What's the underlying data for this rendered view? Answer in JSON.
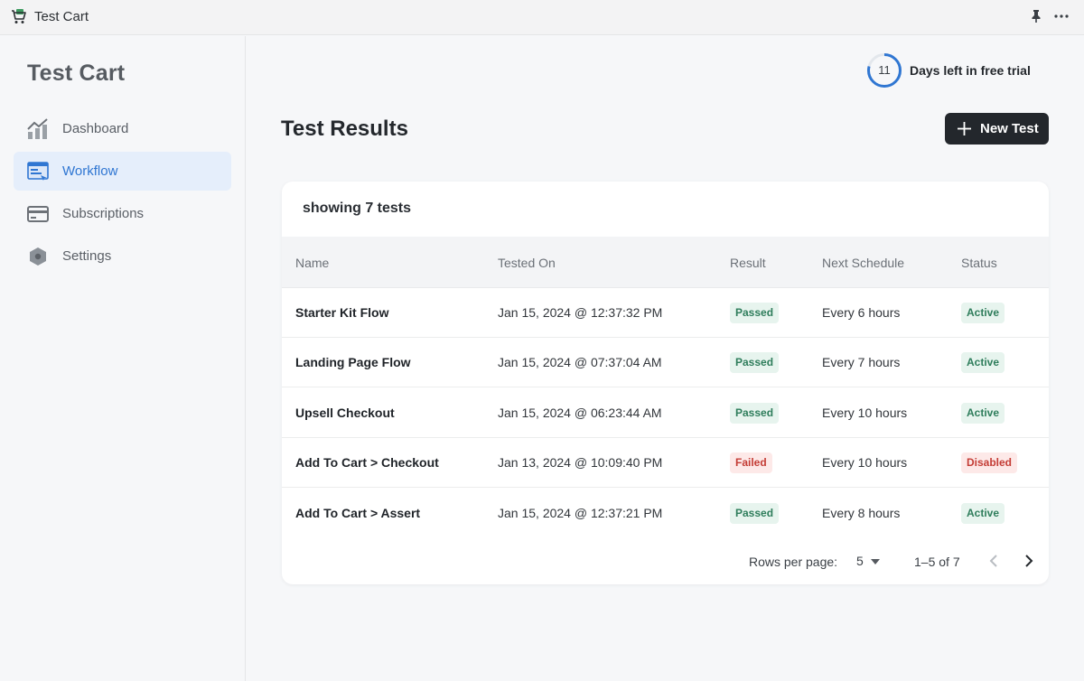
{
  "window": {
    "title": "Test Cart"
  },
  "sidebar": {
    "brand": "Test Cart",
    "items": [
      {
        "label": "Dashboard",
        "icon": "chart-icon"
      },
      {
        "label": "Workflow",
        "icon": "workflow-icon",
        "active": true
      },
      {
        "label": "Subscriptions",
        "icon": "credit-card-icon"
      },
      {
        "label": "Settings",
        "icon": "hexagon-settings-icon"
      }
    ]
  },
  "trial": {
    "days": "11",
    "text": "Days left in free trial",
    "progress": 0.79
  },
  "main": {
    "title": "Test Results",
    "new_test_label": "New Test",
    "showing": "showing 7 tests"
  },
  "table": {
    "columns": [
      "Name",
      "Tested On",
      "Result",
      "Next Schedule",
      "Status"
    ],
    "rows": [
      {
        "name": "Starter Kit Flow",
        "tested_on": "Jan 15, 2024 @ 12:37:32 PM",
        "result": "Passed",
        "schedule": "Every 6 hours",
        "status": "Active"
      },
      {
        "name": "Landing Page Flow",
        "tested_on": "Jan 15, 2024 @ 07:37:04 AM",
        "result": "Passed",
        "schedule": "Every 7 hours",
        "status": "Active"
      },
      {
        "name": "Upsell Checkout",
        "tested_on": "Jan 15, 2024 @ 06:23:44 AM",
        "result": "Passed",
        "schedule": "Every 10 hours",
        "status": "Active"
      },
      {
        "name": "Add To Cart > Checkout",
        "tested_on": "Jan 13, 2024 @ 10:09:40 PM",
        "result": "Failed",
        "schedule": "Every 10 hours",
        "status": "Disabled"
      },
      {
        "name": "Add To Cart > Assert",
        "tested_on": "Jan 15, 2024 @ 12:37:21 PM",
        "result": "Passed",
        "schedule": "Every 8 hours",
        "status": "Active"
      }
    ]
  },
  "pagination": {
    "rows_per_page_label": "Rows per page:",
    "rows_per_page": "5",
    "range": "1–5 of 7"
  },
  "colors": {
    "accent": "#2f76d2",
    "button_dark": "#23272c",
    "success_bg": "#e7f4ee",
    "success_text": "#2e7d5b",
    "danger_bg": "#fde9e8",
    "danger_text": "#c43d36"
  }
}
